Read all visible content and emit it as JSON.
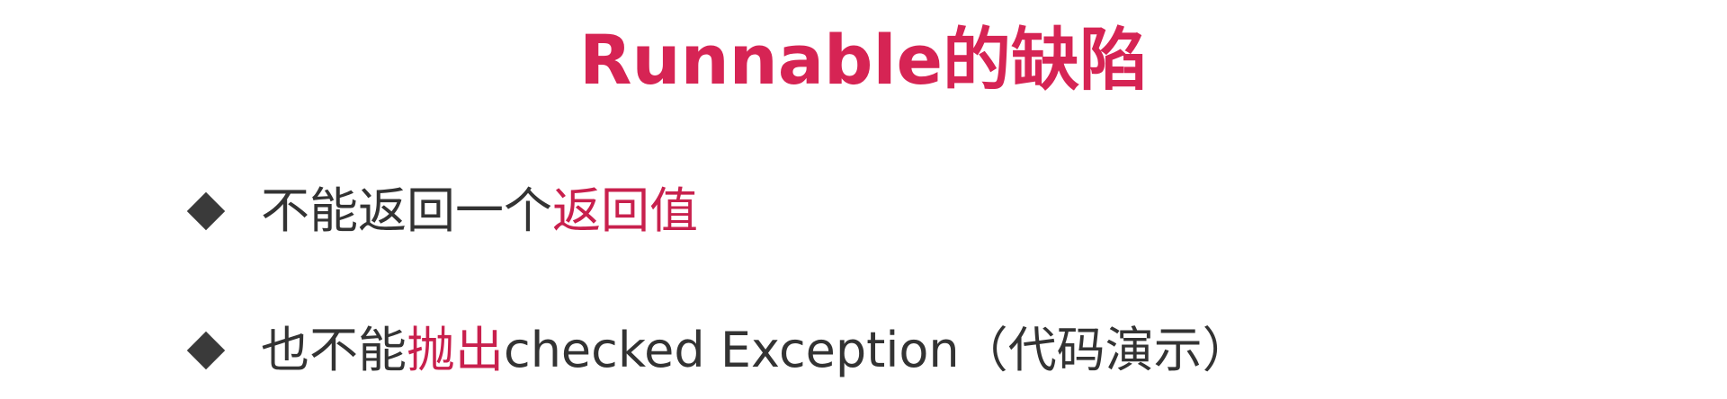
{
  "slide": {
    "title": "Runnable的缺陷",
    "bullets": [
      {
        "text_before": "不能返回一个",
        "highlight": "返回值",
        "text_after": ""
      },
      {
        "text_before": "也不能",
        "highlight": "抛出",
        "text_after": "checked Exception（代码演示）"
      }
    ]
  },
  "colors": {
    "title": "#d62454",
    "highlight": "#c8204d",
    "body_text": "#333333",
    "bullet_marker": "#3a3a3a",
    "background": "#ffffff"
  },
  "icons": {
    "bullet_marker": "diamond-bullet-icon"
  }
}
